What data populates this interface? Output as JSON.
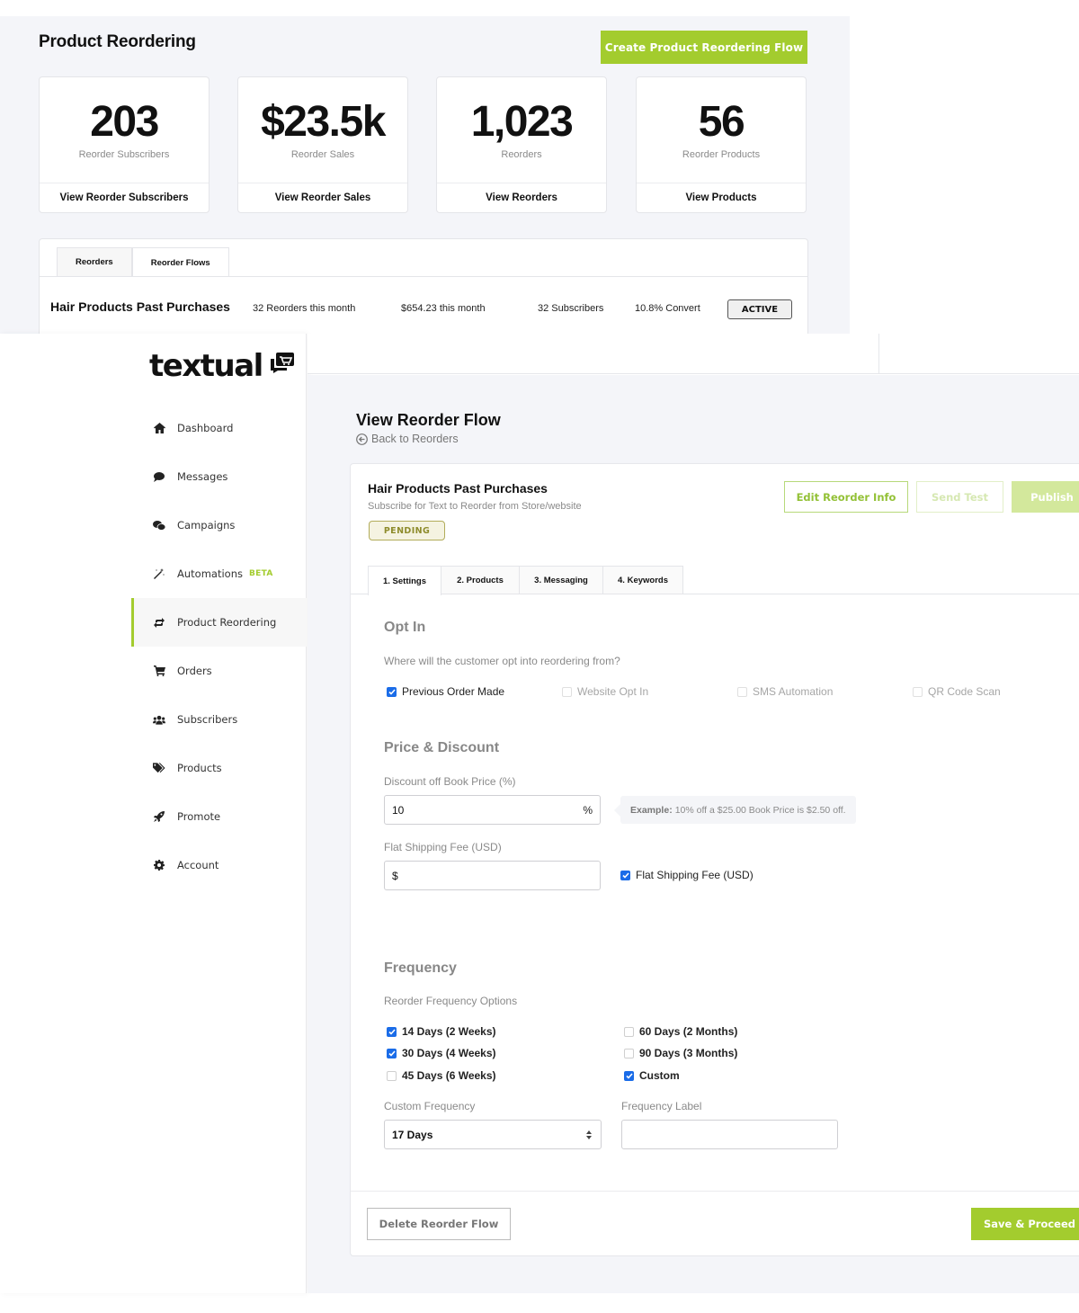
{
  "dashboard": {
    "title": "Product Reordering",
    "create_button": "Create Product Reordering Flow",
    "stats": [
      {
        "value": "203",
        "label": "Reorder Subscribers",
        "link": "View Reorder Subscribers"
      },
      {
        "value": "$23.5k",
        "label": "Reorder Sales",
        "link": "View Reorder Sales"
      },
      {
        "value": "1,023",
        "label": "Reorders",
        "link": "View Reorders"
      },
      {
        "value": "56",
        "label": "Reorder Products",
        "link": "View Products"
      }
    ],
    "tabs": [
      {
        "label": "Reorders",
        "active": false
      },
      {
        "label": "Reorder Flows",
        "active": true
      }
    ],
    "flow_row": {
      "name": "Hair Products Past Purchases",
      "reorders": "32 Reorders this month",
      "sales": "$654.23 this month",
      "subscribers": "32 Subscribers",
      "convert": "10.8% Convert",
      "status": "ACTIVE"
    }
  },
  "sidebar": {
    "logo": "textual",
    "items": [
      {
        "label": "Dashboard",
        "icon": "home-icon"
      },
      {
        "label": "Messages",
        "icon": "chat-bubble-icon"
      },
      {
        "label": "Campaigns",
        "icon": "comments-icon"
      },
      {
        "label": "Automations",
        "icon": "magic-wand-icon",
        "badge": "BETA"
      },
      {
        "label": "Product Reordering",
        "icon": "repeat-icon",
        "active": true
      },
      {
        "label": "Orders",
        "icon": "cart-icon"
      },
      {
        "label": "Subscribers",
        "icon": "users-icon"
      },
      {
        "label": "Products",
        "icon": "tags-icon"
      },
      {
        "label": "Promote",
        "icon": "rocket-icon"
      },
      {
        "label": "Account",
        "icon": "gear-icon"
      }
    ]
  },
  "page": {
    "title": "View Reorder Flow",
    "back_link": "Back to Reorders"
  },
  "flow": {
    "name": "Hair Products Past Purchases",
    "subtitle": "Subscribe for Text to Reorder from Store/website",
    "status": "PENDING",
    "buttons": {
      "edit": "Edit Reorder Info",
      "send_test": "Send Test",
      "publish": "Publish"
    },
    "steps": [
      {
        "label": "1. Settings",
        "active": true
      },
      {
        "label": "2. Products",
        "active": false
      },
      {
        "label": "3. Messaging",
        "active": false
      },
      {
        "label": "4. Keywords",
        "active": false
      }
    ]
  },
  "opt_in": {
    "title": "Opt In",
    "question": "Where will the customer opt into reordering from?",
    "options": [
      {
        "label": "Previous Order Made",
        "checked": true
      },
      {
        "label": "Website Opt In",
        "checked": false
      },
      {
        "label": "SMS Automation",
        "checked": false
      },
      {
        "label": "QR Code Scan",
        "checked": false
      }
    ]
  },
  "price": {
    "title": "Price & Discount",
    "discount_label": "Discount off Book Price (%)",
    "discount_value": "10",
    "discount_suffix": "%",
    "example_bold": "Example:",
    "example_text": "10% off a $25.00 Book Price is $2.50 off.",
    "shipping_label": "Flat Shipping Fee (USD)",
    "shipping_value": "$",
    "shipping_checkbox": {
      "label": "Flat Shipping Fee (USD)",
      "checked": true
    }
  },
  "frequency": {
    "title": "Frequency",
    "options_label": "Reorder Frequency Options",
    "options": [
      {
        "label": "14 Days (2 Weeks)",
        "checked": true
      },
      {
        "label": "30 Days (4 Weeks)",
        "checked": true
      },
      {
        "label": "45 Days (6 Weeks)",
        "checked": false
      },
      {
        "label": "60 Days (2 Months)",
        "checked": false
      },
      {
        "label": "90 Days (3 Months)",
        "checked": false
      },
      {
        "label": "Custom",
        "checked": true
      }
    ],
    "custom_label": "Custom Frequency",
    "custom_value": "17 Days",
    "freq_label_label": "Frequency Label",
    "freq_label_value": ""
  },
  "footer": {
    "delete": "Delete Reorder Flow",
    "save": "Save & Proceed"
  },
  "colors": {
    "accent": "#a3cc2e",
    "checkbox": "#1a6ce8",
    "pending": "#8e8c2c"
  }
}
